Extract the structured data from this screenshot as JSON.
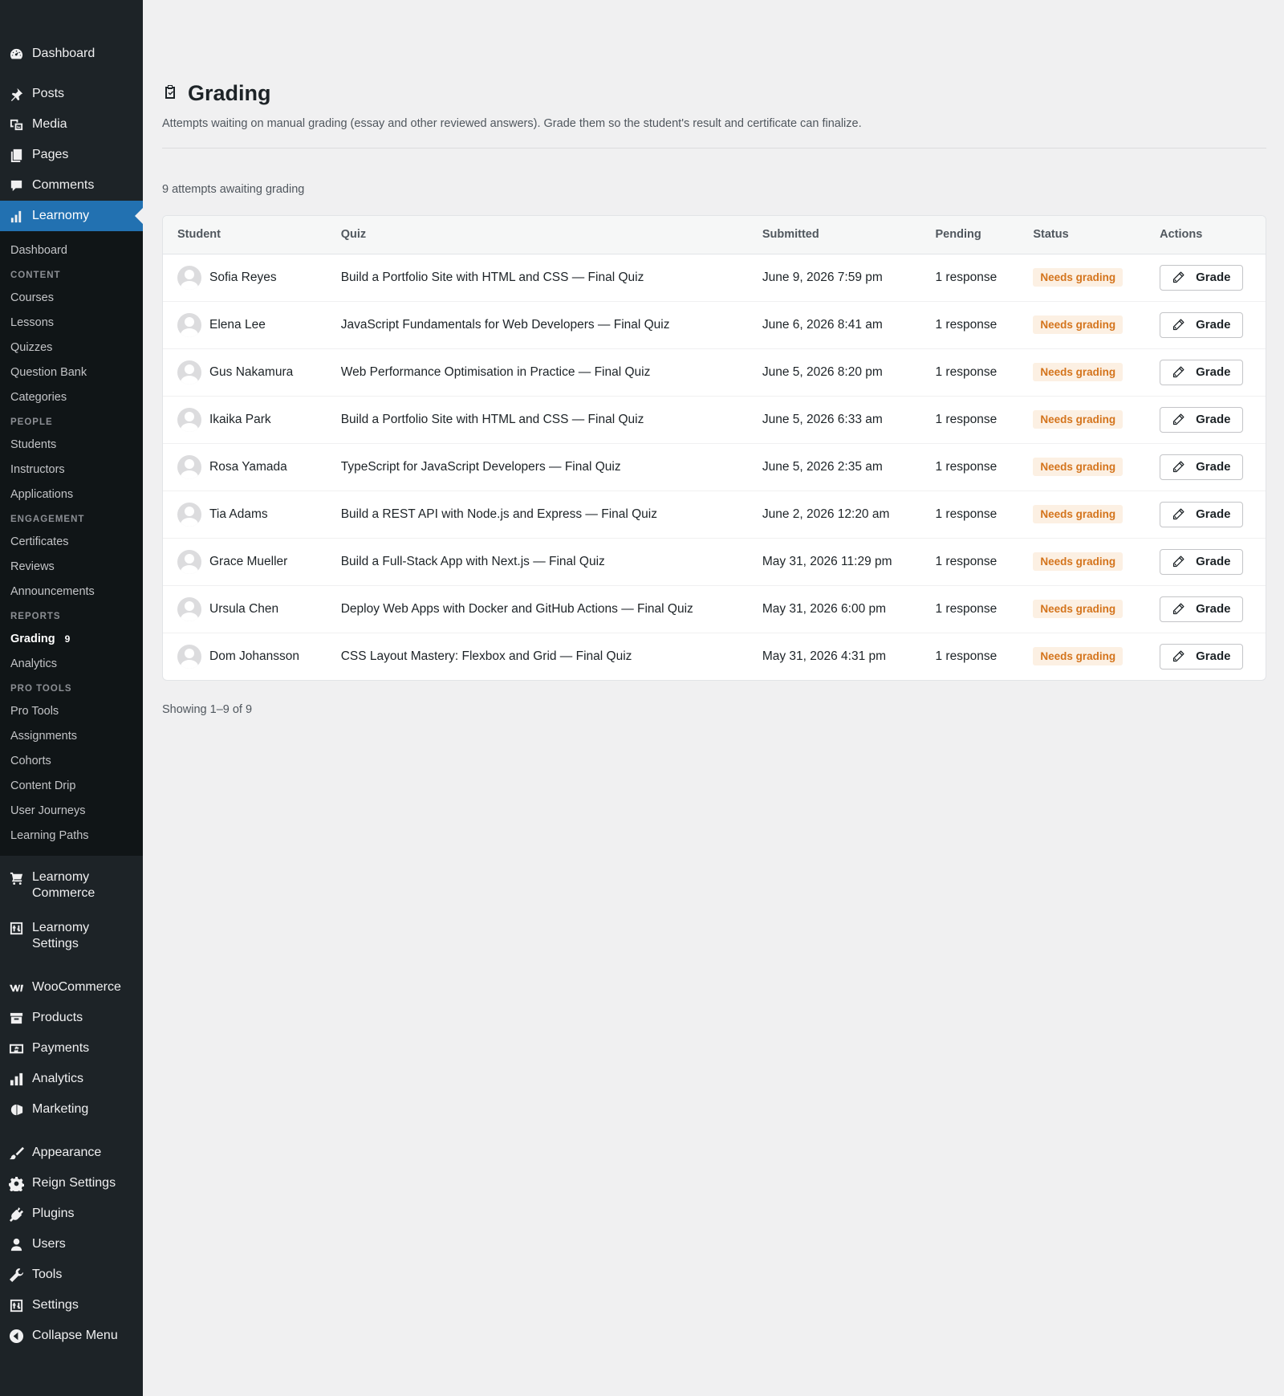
{
  "sidebar": {
    "top_items": [
      {
        "label": "Dashboard",
        "icon": "dashboard-icon"
      },
      {
        "label": "Posts",
        "icon": "pin-icon"
      },
      {
        "label": "Media",
        "icon": "media-icon"
      },
      {
        "label": "Pages",
        "icon": "pages-icon"
      },
      {
        "label": "Comments",
        "icon": "comments-icon"
      },
      {
        "label": "Learnomy",
        "icon": "chart-icon",
        "active": true
      }
    ],
    "submenu": {
      "dashboard": "Dashboard",
      "content_head": "CONTENT",
      "content": [
        "Courses",
        "Lessons",
        "Quizzes",
        "Question Bank",
        "Categories"
      ],
      "people_head": "PEOPLE",
      "people": [
        "Students",
        "Instructors",
        "Applications"
      ],
      "engagement_head": "ENGAGEMENT",
      "engagement": [
        "Certificates",
        "Reviews",
        "Announcements"
      ],
      "reports_head": "REPORTS",
      "grading": "Grading",
      "grading_count": "9",
      "analytics": "Analytics",
      "protools_head": "PRO TOOLS",
      "protools": [
        "Pro Tools",
        "Assignments",
        "Cohorts",
        "Content Drip",
        "User Journeys",
        "Learning Paths"
      ]
    },
    "learnomy_commerce": [
      "Learnomy",
      "Commerce"
    ],
    "learnomy_settings": [
      "Learnomy",
      "Settings"
    ],
    "woo_items": [
      {
        "label": "WooCommerce",
        "icon": "woo-icon"
      },
      {
        "label": "Products",
        "icon": "archive-icon"
      },
      {
        "label": "Payments",
        "icon": "payments-icon"
      },
      {
        "label": "Analytics",
        "icon": "bar-chart-icon"
      },
      {
        "label": "Marketing",
        "icon": "megaphone-icon"
      }
    ],
    "bottom_items": [
      {
        "label": "Appearance",
        "icon": "brush-icon"
      },
      {
        "label": "Reign Settings",
        "icon": "gear-icon"
      },
      {
        "label": "Plugins",
        "icon": "plugin-icon"
      },
      {
        "label": "Users",
        "icon": "user-icon"
      },
      {
        "label": "Tools",
        "icon": "wrench-icon"
      },
      {
        "label": "Settings",
        "icon": "settings-icon"
      },
      {
        "label": "Collapse Menu",
        "icon": "collapse-icon"
      }
    ]
  },
  "page": {
    "title": "Grading",
    "title_icon": "clipboard-check-icon",
    "description": "Attempts waiting on manual grading (essay and other reviewed answers). Grade them so the student's result and certificate can finalize.",
    "count": "9 attempts awaiting grading",
    "showing": "Showing 1–9 of 9"
  },
  "table": {
    "columns": [
      "Student",
      "Quiz",
      "Submitted",
      "Pending",
      "Status",
      "Actions"
    ],
    "rows": [
      {
        "student": "Sofia Reyes",
        "quiz": "Build a Portfolio Site with HTML and CSS — Final Quiz",
        "submitted": "June 9, 2026 7:59 pm",
        "pending": "1 response",
        "status": "Needs grading",
        "action": "Grade"
      },
      {
        "student": "Elena Lee",
        "quiz": "JavaScript Fundamentals for Web Developers — Final Quiz",
        "submitted": "June 6, 2026 8:41 am",
        "pending": "1 response",
        "status": "Needs grading",
        "action": "Grade"
      },
      {
        "student": "Gus Nakamura",
        "quiz": "Web Performance Optimisation in Practice — Final Quiz",
        "submitted": "June 5, 2026 8:20 pm",
        "pending": "1 response",
        "status": "Needs grading",
        "action": "Grade"
      },
      {
        "student": "Ikaika Park",
        "quiz": "Build a Portfolio Site with HTML and CSS — Final Quiz",
        "submitted": "June 5, 2026 6:33 am",
        "pending": "1 response",
        "status": "Needs grading",
        "action": "Grade"
      },
      {
        "student": "Rosa Yamada",
        "quiz": "TypeScript for JavaScript Developers — Final Quiz",
        "submitted": "June 5, 2026 2:35 am",
        "pending": "1 response",
        "status": "Needs grading",
        "action": "Grade"
      },
      {
        "student": "Tia Adams",
        "quiz": "Build a REST API with Node.js and Express — Final Quiz",
        "submitted": "June 2, 2026 12:20 am",
        "pending": "1 response",
        "status": "Needs grading",
        "action": "Grade"
      },
      {
        "student": "Grace Mueller",
        "quiz": "Build a Full-Stack App with Next.js — Final Quiz",
        "submitted": "May 31, 2026 11:29 pm",
        "pending": "1 response",
        "status": "Needs grading",
        "action": "Grade"
      },
      {
        "student": "Ursula Chen",
        "quiz": "Deploy Web Apps with Docker and GitHub Actions — Final Quiz",
        "submitted": "May 31, 2026 6:00 pm",
        "pending": "1 response",
        "status": "Needs grading",
        "action": "Grade"
      },
      {
        "student": "Dom Johansson",
        "quiz": "CSS Layout Mastery: Flexbox and Grid — Final Quiz",
        "submitted": "May 31, 2026 4:31 pm",
        "pending": "1 response",
        "status": "Needs grading",
        "action": "Grade"
      }
    ]
  },
  "colors": {
    "sidebar_bg": "#1d2327",
    "submenu_bg": "#101517",
    "active_bg": "#2271b1",
    "badge_text": "#d4741c",
    "badge_bg": "#fcf0e3",
    "page_bg": "#f0f0f1"
  }
}
